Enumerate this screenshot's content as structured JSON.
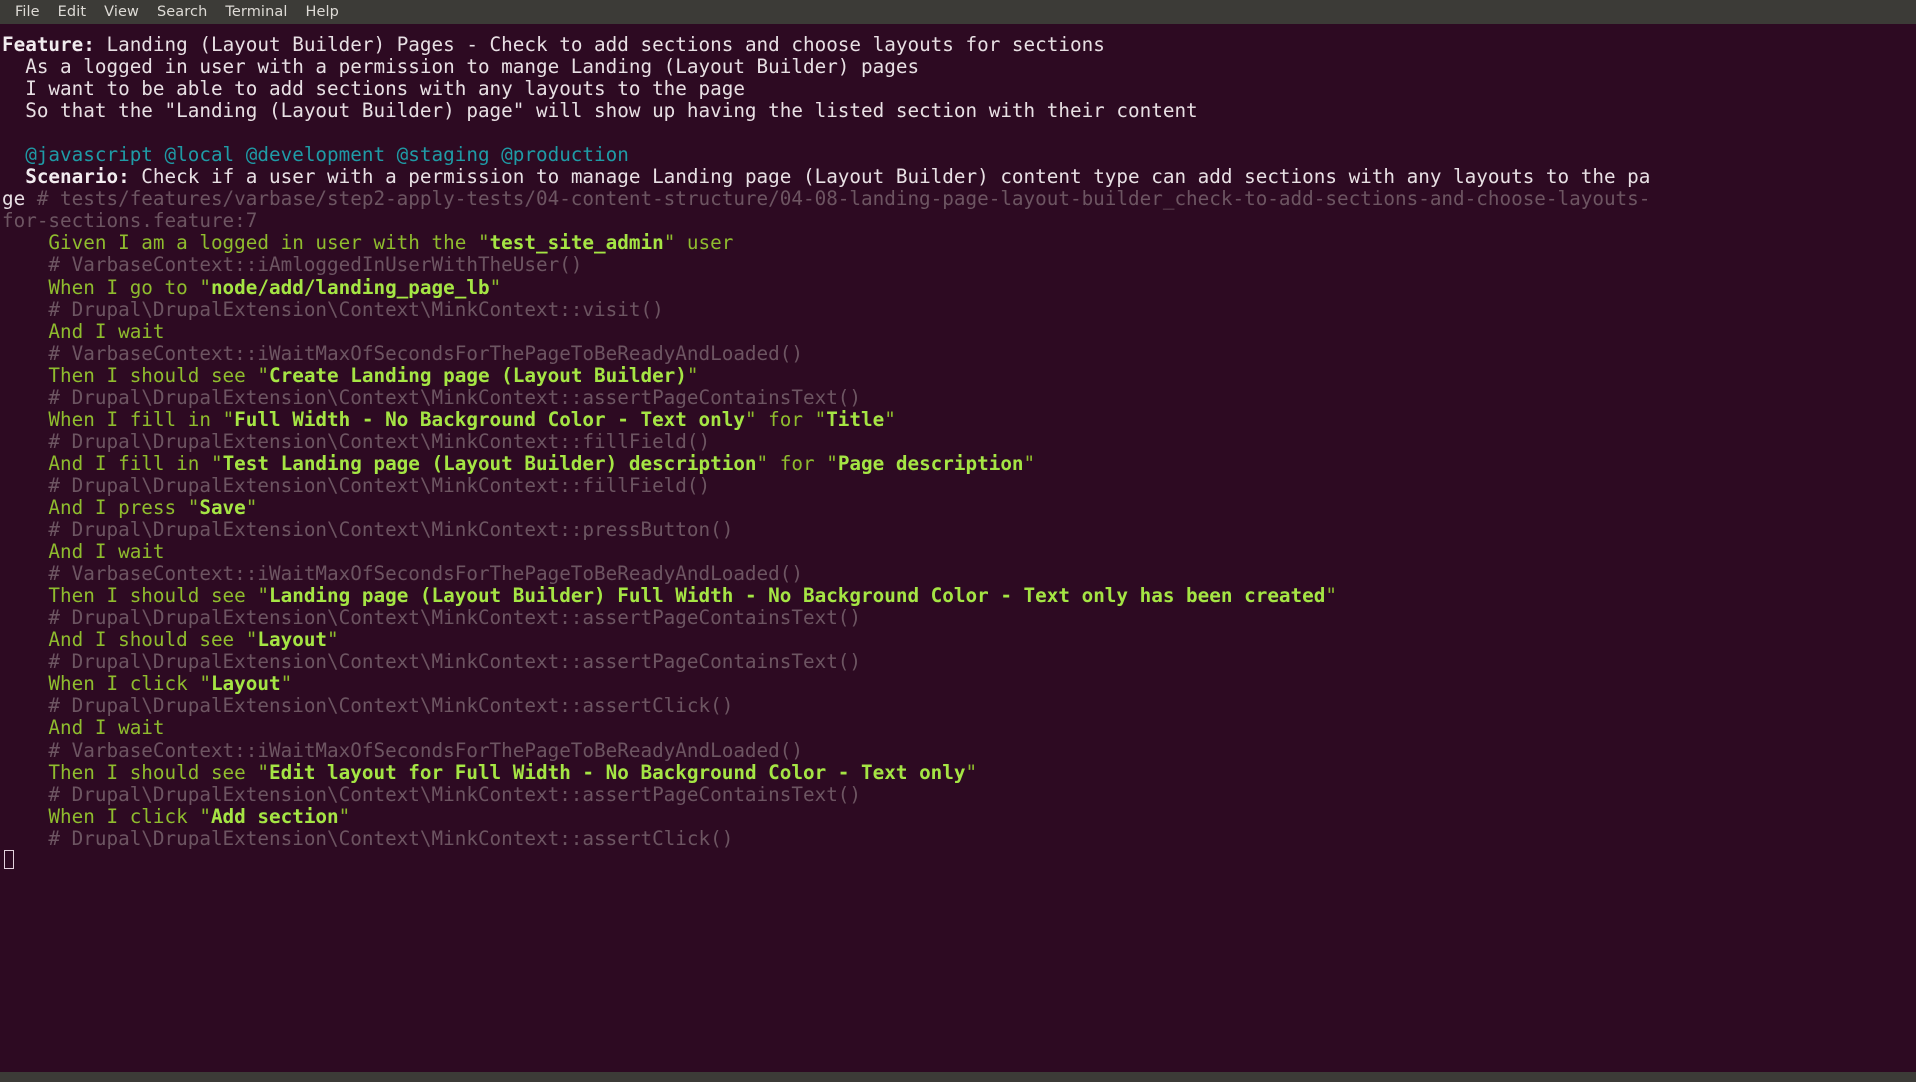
{
  "window": {
    "title": "Terminal",
    "background_color": "#2d0a22",
    "menubar_color": "#3c3b37"
  },
  "menu": {
    "items": [
      {
        "label": "File"
      },
      {
        "label": "Edit"
      },
      {
        "label": "View"
      },
      {
        "label": "Search"
      },
      {
        "label": "Terminal"
      },
      {
        "label": "Help"
      }
    ]
  },
  "colors": {
    "text": "#e8e0e4",
    "tag": "#1f9ba6",
    "comment": "#6d5562",
    "step": "#8fbc2e",
    "param": "#a5e544"
  },
  "terminal": {
    "lines": [
      {
        "id": "feature-line",
        "name": "feature-header-line",
        "segments": [
          {
            "class": "c-bold",
            "text": "Feature:"
          },
          {
            "class": "c-white",
            "text": " Landing (Layout Builder) Pages - Check to add sections and choose layouts for sections"
          }
        ]
      },
      {
        "id": "narrative-1",
        "name": "feature-narrative-line",
        "segments": [
          {
            "class": "c-white",
            "text": "  As a logged in user with a permission to mange Landing (Layout Builder) pages"
          }
        ]
      },
      {
        "id": "narrative-2",
        "name": "feature-narrative-line",
        "segments": [
          {
            "class": "c-white",
            "text": "  I want to be able to add sections with any layouts to the page"
          }
        ]
      },
      {
        "id": "narrative-3",
        "name": "feature-narrative-line",
        "segments": [
          {
            "class": "c-white",
            "text": "  So that the \"Landing (Layout Builder) page\" will show up having the listed section with their content"
          }
        ]
      },
      {
        "id": "blank-1",
        "name": "blank-line",
        "segments": [
          {
            "class": "c-white",
            "text": ""
          }
        ]
      },
      {
        "id": "tags-line",
        "name": "scenario-tags-line",
        "segments": [
          {
            "class": "c-tag",
            "text": "  @javascript @local @development @staging @production"
          }
        ]
      },
      {
        "id": "scenario-line",
        "name": "scenario-header-line",
        "segments": [
          {
            "class": "c-bold",
            "text": "  Scenario:"
          },
          {
            "class": "c-white",
            "text": " Check if a user with a permission to manage Landing page (Layout Builder) content type can add sections with any layouts to the pa"
          }
        ]
      },
      {
        "id": "scenario-path-line",
        "name": "scenario-source-path-line",
        "segments": [
          {
            "class": "c-white",
            "text": "ge"
          },
          {
            "class": "c-comment",
            "text": " # tests/features/varbase/step2-apply-tests/04-content-structure/04-08-landing-page-layout-builder_check-to-add-sections-and-choose-layouts-"
          }
        ]
      },
      {
        "id": "scenario-path-line-2",
        "name": "scenario-source-path-line-wrap",
        "segments": [
          {
            "class": "c-comment",
            "text": "for-sections.feature:7"
          }
        ]
      },
      {
        "id": "step-1",
        "name": "step-line",
        "segments": [
          {
            "class": "c-step",
            "text": "    Given I am a logged in user with the "
          },
          {
            "class": "c-quote",
            "text": "\""
          },
          {
            "class": "c-param",
            "text": "test_site_admin"
          },
          {
            "class": "c-quote",
            "text": "\""
          },
          {
            "class": "c-step",
            "text": " user"
          }
        ]
      },
      {
        "id": "step-1-def",
        "name": "step-definition-line",
        "segments": [
          {
            "class": "c-comment",
            "text": "    # VarbaseContext::iAmloggedInUserWithTheUser()"
          }
        ]
      },
      {
        "id": "step-2",
        "name": "step-line",
        "segments": [
          {
            "class": "c-step",
            "text": "    When I go to "
          },
          {
            "class": "c-quote",
            "text": "\""
          },
          {
            "class": "c-param",
            "text": "node/add/landing_page_lb"
          },
          {
            "class": "c-quote",
            "text": "\""
          }
        ]
      },
      {
        "id": "step-2-def",
        "name": "step-definition-line",
        "segments": [
          {
            "class": "c-comment",
            "text": "    # Drupal\\DrupalExtension\\Context\\MinkContext::visit()"
          }
        ]
      },
      {
        "id": "step-3",
        "name": "step-line",
        "segments": [
          {
            "class": "c-step",
            "text": "    And I wait"
          }
        ]
      },
      {
        "id": "step-3-def",
        "name": "step-definition-line",
        "segments": [
          {
            "class": "c-comment",
            "text": "    # VarbaseContext::iWaitMaxOfSecondsForThePageToBeReadyAndLoaded()"
          }
        ]
      },
      {
        "id": "step-4",
        "name": "step-line",
        "segments": [
          {
            "class": "c-step",
            "text": "    Then I should see "
          },
          {
            "class": "c-quote",
            "text": "\""
          },
          {
            "class": "c-param",
            "text": "Create Landing page (Layout Builder)"
          },
          {
            "class": "c-quote",
            "text": "\""
          }
        ]
      },
      {
        "id": "step-4-def",
        "name": "step-definition-line",
        "segments": [
          {
            "class": "c-comment",
            "text": "    # Drupal\\DrupalExtension\\Context\\MinkContext::assertPageContainsText()"
          }
        ]
      },
      {
        "id": "step-5",
        "name": "step-line",
        "segments": [
          {
            "class": "c-step",
            "text": "    When I fill in "
          },
          {
            "class": "c-quote",
            "text": "\""
          },
          {
            "class": "c-param",
            "text": "Full Width - No Background Color - Text only"
          },
          {
            "class": "c-quote",
            "text": "\""
          },
          {
            "class": "c-step",
            "text": " for "
          },
          {
            "class": "c-quote",
            "text": "\""
          },
          {
            "class": "c-param",
            "text": "Title"
          },
          {
            "class": "c-quote",
            "text": "\""
          }
        ]
      },
      {
        "id": "step-5-def",
        "name": "step-definition-line",
        "segments": [
          {
            "class": "c-comment",
            "text": "    # Drupal\\DrupalExtension\\Context\\MinkContext::fillField()"
          }
        ]
      },
      {
        "id": "step-6",
        "name": "step-line",
        "segments": [
          {
            "class": "c-step",
            "text": "    And I fill in "
          },
          {
            "class": "c-quote",
            "text": "\""
          },
          {
            "class": "c-param",
            "text": "Test Landing page (Layout Builder) description"
          },
          {
            "class": "c-quote",
            "text": "\""
          },
          {
            "class": "c-step",
            "text": " for "
          },
          {
            "class": "c-quote",
            "text": "\""
          },
          {
            "class": "c-param",
            "text": "Page description"
          },
          {
            "class": "c-quote",
            "text": "\""
          }
        ]
      },
      {
        "id": "step-6-def",
        "name": "step-definition-line",
        "segments": [
          {
            "class": "c-comment",
            "text": "    # Drupal\\DrupalExtension\\Context\\MinkContext::fillField()"
          }
        ]
      },
      {
        "id": "step-7",
        "name": "step-line",
        "segments": [
          {
            "class": "c-step",
            "text": "    And I press "
          },
          {
            "class": "c-quote",
            "text": "\""
          },
          {
            "class": "c-param",
            "text": "Save"
          },
          {
            "class": "c-quote",
            "text": "\""
          }
        ]
      },
      {
        "id": "step-7-def",
        "name": "step-definition-line",
        "segments": [
          {
            "class": "c-comment",
            "text": "    # Drupal\\DrupalExtension\\Context\\MinkContext::pressButton()"
          }
        ]
      },
      {
        "id": "step-8",
        "name": "step-line",
        "segments": [
          {
            "class": "c-step",
            "text": "    And I wait"
          }
        ]
      },
      {
        "id": "step-8-def",
        "name": "step-definition-line",
        "segments": [
          {
            "class": "c-comment",
            "text": "    # VarbaseContext::iWaitMaxOfSecondsForThePageToBeReadyAndLoaded()"
          }
        ]
      },
      {
        "id": "step-9",
        "name": "step-line",
        "segments": [
          {
            "class": "c-step",
            "text": "    Then I should see "
          },
          {
            "class": "c-quote",
            "text": "\""
          },
          {
            "class": "c-param",
            "text": "Landing page (Layout Builder) Full Width - No Background Color - Text only has been created"
          },
          {
            "class": "c-quote",
            "text": "\""
          }
        ]
      },
      {
        "id": "step-9-def",
        "name": "step-definition-line",
        "segments": [
          {
            "class": "c-comment",
            "text": "    # Drupal\\DrupalExtension\\Context\\MinkContext::assertPageContainsText()"
          }
        ]
      },
      {
        "id": "step-10",
        "name": "step-line",
        "segments": [
          {
            "class": "c-step",
            "text": "    And I should see "
          },
          {
            "class": "c-quote",
            "text": "\""
          },
          {
            "class": "c-param",
            "text": "Layout"
          },
          {
            "class": "c-quote",
            "text": "\""
          }
        ]
      },
      {
        "id": "step-10-def",
        "name": "step-definition-line",
        "segments": [
          {
            "class": "c-comment",
            "text": "    # Drupal\\DrupalExtension\\Context\\MinkContext::assertPageContainsText()"
          }
        ]
      },
      {
        "id": "step-11",
        "name": "step-line",
        "segments": [
          {
            "class": "c-step",
            "text": "    When I click "
          },
          {
            "class": "c-quote",
            "text": "\""
          },
          {
            "class": "c-param",
            "text": "Layout"
          },
          {
            "class": "c-quote",
            "text": "\""
          }
        ]
      },
      {
        "id": "step-11-def",
        "name": "step-definition-line",
        "segments": [
          {
            "class": "c-comment",
            "text": "    # Drupal\\DrupalExtension\\Context\\MinkContext::assertClick()"
          }
        ]
      },
      {
        "id": "step-12",
        "name": "step-line",
        "segments": [
          {
            "class": "c-step",
            "text": "    And I wait"
          }
        ]
      },
      {
        "id": "step-12-def",
        "name": "step-definition-line",
        "segments": [
          {
            "class": "c-comment",
            "text": "    # VarbaseContext::iWaitMaxOfSecondsForThePageToBeReadyAndLoaded()"
          }
        ]
      },
      {
        "id": "step-13",
        "name": "step-line",
        "segments": [
          {
            "class": "c-step",
            "text": "    Then I should see "
          },
          {
            "class": "c-quote",
            "text": "\""
          },
          {
            "class": "c-param",
            "text": "Edit layout for Full Width - No Background Color - Text only"
          },
          {
            "class": "c-quote",
            "text": "\""
          }
        ]
      },
      {
        "id": "step-13-def",
        "name": "step-definition-line",
        "segments": [
          {
            "class": "c-comment",
            "text": "    # Drupal\\DrupalExtension\\Context\\MinkContext::assertPageContainsText()"
          }
        ]
      },
      {
        "id": "step-14",
        "name": "step-line",
        "segments": [
          {
            "class": "c-step",
            "text": "    When I click "
          },
          {
            "class": "c-quote",
            "text": "\""
          },
          {
            "class": "c-param",
            "text": "Add section"
          },
          {
            "class": "c-quote",
            "text": "\""
          }
        ]
      },
      {
        "id": "step-14-def",
        "name": "step-definition-line",
        "segments": [
          {
            "class": "c-comment",
            "text": "    # Drupal\\DrupalExtension\\Context\\MinkContext::assertClick()"
          }
        ]
      }
    ],
    "cursor": {
      "name": "text-cursor",
      "visible": true
    }
  }
}
